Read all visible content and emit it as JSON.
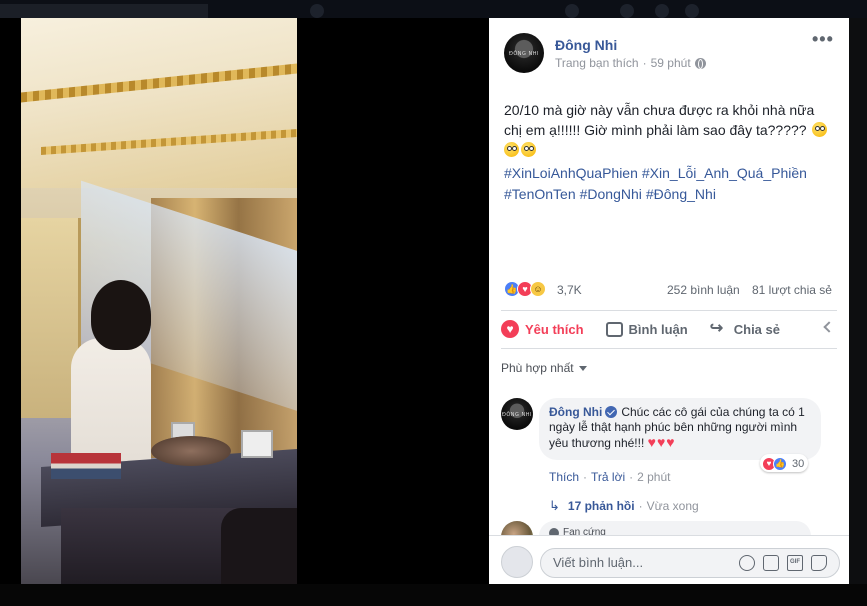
{
  "post": {
    "author": "Đông Nhi",
    "meta_audience": "Trang bạn thích",
    "meta_separator": "·",
    "meta_time": "59 phút",
    "more_label": "•••",
    "text_line1": "20/10 mà giờ này vẫn chưa được ra khỏi nhà nữa",
    "text_line2": "chị em ạ!!!!!! Giờ mình phải làm sao đây ta?????",
    "hashtags": [
      "#XinLoiAnhQuaPhien",
      "#Xin_Lỗi_Anh_Quá_Phiền",
      "#TenOnTen",
      "#DongNhi",
      "#Đông_Nhi"
    ]
  },
  "stats": {
    "reactions": "3,7K",
    "comments": "252 bình luận",
    "shares": "81 lượt chia sẻ"
  },
  "actions": {
    "like": "Yêu thích",
    "comment": "Bình luận",
    "share": "Chia sẻ"
  },
  "sort": {
    "label": "Phù hợp nhất"
  },
  "top_comment": {
    "name": "Đông Nhi",
    "text": "Chúc các cô gái của chúng ta có 1 ngày lễ thật hạnh phúc bên những người mình yêu thương nhé!!!",
    "hearts": "♥♥♥",
    "reaction_count": "30",
    "like_link": "Thích",
    "reply_link": "Trả lời",
    "time": "2 phút",
    "replies_label": "17 phản hồi",
    "replies_time": "Vừa xong"
  },
  "second_comment": {
    "badge": "Fan cứng"
  },
  "composer": {
    "placeholder": "Viết bình luận...",
    "gif_label": "GIF"
  },
  "avatar_logo": "ĐÔNG NHI",
  "colors": {
    "link_blue": "#385898",
    "love_red": "#f33e58",
    "like_blue": "#4c7ff7"
  }
}
